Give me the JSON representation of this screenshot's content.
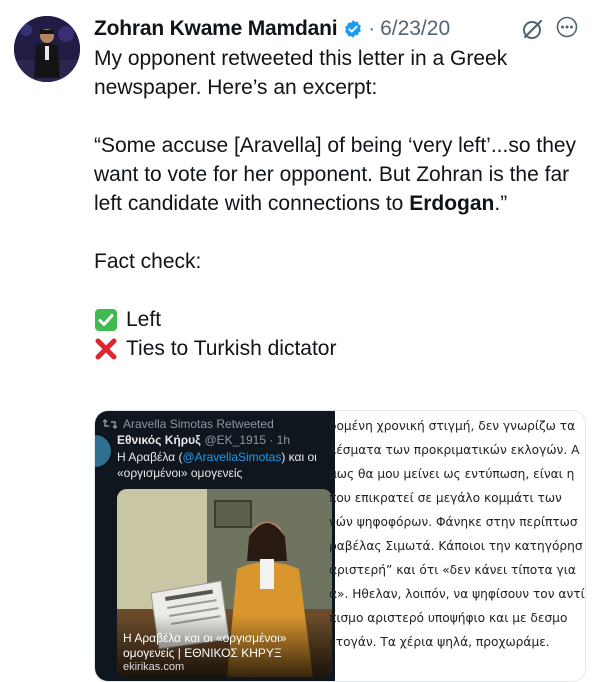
{
  "tweet": {
    "author_name": "Zohran Kwame Mamdani",
    "date": "6/23/20",
    "separator": "·",
    "line1": "My opponent retweeted this letter in a Greek newspaper. Here’s an excerpt:",
    "quote_part1": "“Some accuse [Aravella] of being ‘very left’...so they want to vote for her opponent. But Zohran is the far left candidate with connections to ",
    "quote_bold": "Erdogan",
    "quote_end": ".”",
    "fact_check": "Fact check:",
    "item1": "Left",
    "item2": "Ties to Turkish dictator"
  },
  "icons": {
    "verified": "verified-badge-icon",
    "grok": "grok-icon",
    "more": "more-icon",
    "check": "check-mark-icon",
    "cross": "cross-mark-icon"
  },
  "colors": {
    "verified_blue": "#1d9bf0",
    "check_green": "#3fb950",
    "cross_red": "#e0242f",
    "text": "#0f1419",
    "muted": "#536471"
  },
  "embedded": {
    "retweet_label": "Aravella Simotas Retweeted",
    "account_name": "Εθνικός Κήρυξ",
    "account_handle": "@EK_1915 · 1h",
    "text_prefix": "Η Αραβέλα (",
    "mention": "@AravellaSimotas",
    "text_suffix": ") και οι «οργισμένοι» ομογενείς",
    "card_title": "Η Αραβέλα και οι «οργισμένοι» ομογενείς | ΕΘΝΙΚΟΣ ΚΗΡΥΞ",
    "card_domain": "ekirikas.com",
    "doc_lines": [
      "δομένη χρονική στιγμή, δεν γνωρίζω τα",
      "λέσματα των προκριματικών εκλογών. Α",
      "μως θα μου μείνει ως εντύπωση, είναι η",
      "που επικρατεί σε μεγάλο κομμάτι των",
      "νών ψηφοφόρων. Φάνηκε στην περίπτωσ",
      "ραβέλας Σιμωτά. Κάποιοι την κατηγόρησ",
      "αριστερή” και ότι «δεν κάνει τίποτα για",
      "α». Ηθελαν, λοιπόν, να ψηφίσουν τον αντί",
      "πισμο αριστερό υποψήφιο και με δεσμο",
      "ντογάν. Τα χέρια ψηλά, προχωράμε.",
      "."
    ]
  }
}
